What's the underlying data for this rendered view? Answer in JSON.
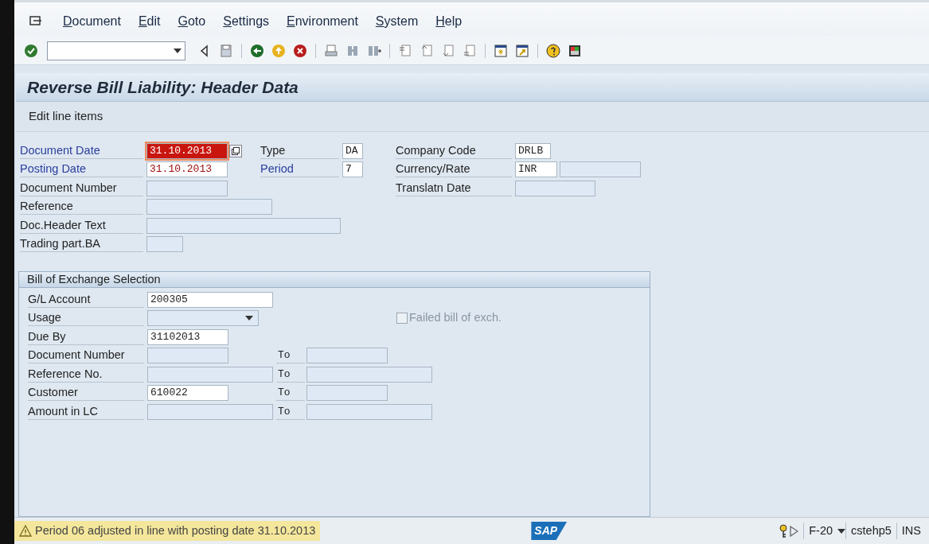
{
  "menu": [
    {
      "label": "Document"
    },
    {
      "label": "Edit"
    },
    {
      "label": "Goto"
    },
    {
      "label": "Settings"
    },
    {
      "label": "Environment"
    },
    {
      "label": "System"
    },
    {
      "label": "Help"
    }
  ],
  "title": "Reverse Bill Liability: Header Data",
  "app_toolbar": [
    {
      "label": "Edit line items"
    }
  ],
  "header": {
    "left": [
      {
        "label": "Document Date",
        "emphasized": true,
        "value": "31.10.2013",
        "focused": true,
        "calendar": true
      },
      {
        "label": "Posting Date",
        "emphasized": true,
        "value": "31.10.2013",
        "focused": false
      },
      {
        "label": "Document Number",
        "emphasized": false,
        "focused": false
      },
      {
        "label": "Reference",
        "emphasized": false,
        "focused": false
      },
      {
        "label": "Doc.Header Text",
        "emphasized": false,
        "focused": false
      },
      {
        "label": "Trading part.BA",
        "emphasized": false,
        "focused": false
      }
    ],
    "middle": [
      {
        "label": "Type",
        "emphasized": false,
        "value": "DA",
        "focused": false
      },
      {
        "label": "Period",
        "emphasized": true,
        "value": "7",
        "focused": false
      }
    ],
    "right": [
      {
        "label": "Company Code",
        "emphasized": false,
        "value": "DRLB",
        "focused": false
      },
      {
        "label": "Currency/Rate",
        "emphasized": false,
        "value": "INR",
        "focused": false,
        "extra_field": true
      },
      {
        "label": "Translatn Date",
        "emphasized": false,
        "focused": false
      }
    ]
  },
  "selection": {
    "title": "Bill of Exchange Selection",
    "rows": [
      {
        "label": "G/L Account",
        "kind": "text",
        "value": "200305"
      },
      {
        "label": "Usage",
        "kind": "dropdown"
      },
      {
        "label": "Due By",
        "kind": "text",
        "value": "31102013"
      },
      {
        "label": "Document Number",
        "kind": "text",
        "to_label": "To"
      },
      {
        "label": "Reference No.",
        "kind": "text",
        "to_label": "To"
      },
      {
        "label": "Customer",
        "kind": "text",
        "value": "610022",
        "to_label": "To"
      },
      {
        "label": "Amount in LC",
        "kind": "text",
        "to_label": "To"
      }
    ],
    "checkbox": {
      "label": "Failed bill of exch.",
      "checked": false,
      "disabled": true
    }
  },
  "status_bar": {
    "message": "Period 06 adjusted in line with posting date 31.10.2013",
    "warning": true,
    "logo": "SAP",
    "transaction": "F-20",
    "server": "cstehp5",
    "mode": "INS"
  }
}
